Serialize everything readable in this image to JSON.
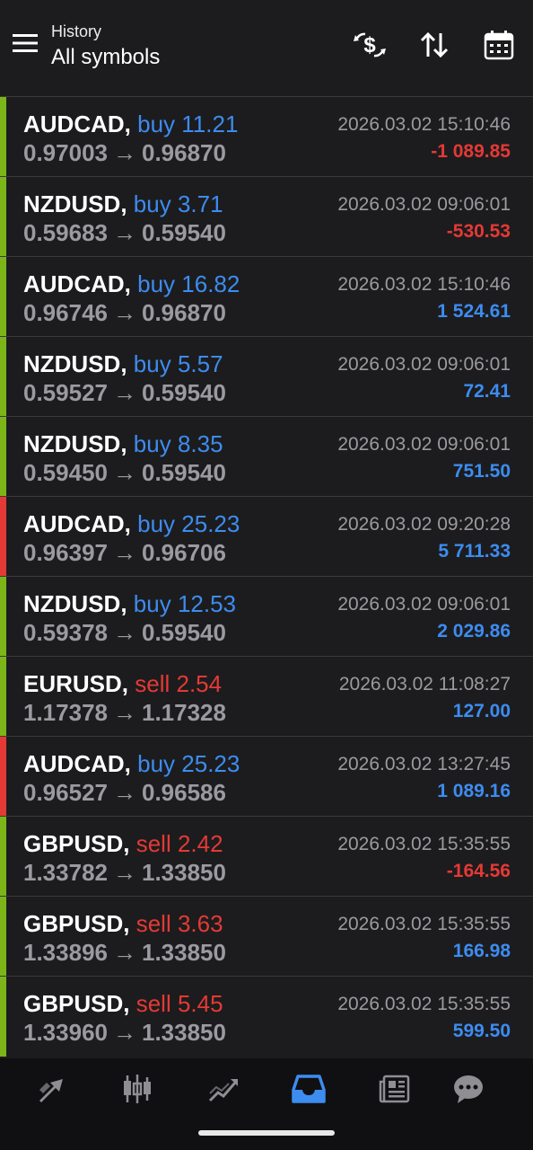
{
  "header": {
    "subtitle": "History",
    "title": "All symbols",
    "icons": [
      "menu-icon",
      "dollar-exchange-icon",
      "sort-icon",
      "calendar-icon"
    ]
  },
  "colors": {
    "background": "#1c1c1e",
    "buy": "#3d8cf0",
    "sell": "#e53935",
    "positive": "#3d8cf0",
    "negative": "#e53935",
    "bar_green": "#7cb518",
    "bar_red": "#e53935",
    "active_nav": "#3d8cf0"
  },
  "deals": [
    {
      "symbol": "AUDCAD,",
      "side": "buy",
      "volume": "buy 11.21",
      "open_price": "0.97003",
      "close_price": "0.96870",
      "time": "2026.03.02 15:10:46",
      "profit": "-1 089.85",
      "profit_sign": "neg",
      "bar": "green"
    },
    {
      "symbol": "NZDUSD,",
      "side": "buy",
      "volume": "buy 3.71",
      "open_price": "0.59683",
      "close_price": "0.59540",
      "time": "2026.03.02 09:06:01",
      "profit": "-530.53",
      "profit_sign": "neg",
      "bar": "green"
    },
    {
      "symbol": "AUDCAD,",
      "side": "buy",
      "volume": "buy 16.82",
      "open_price": "0.96746",
      "close_price": "0.96870",
      "time": "2026.03.02 15:10:46",
      "profit": "1 524.61",
      "profit_sign": "pos",
      "bar": "green"
    },
    {
      "symbol": "NZDUSD,",
      "side": "buy",
      "volume": "buy 5.57",
      "open_price": "0.59527",
      "close_price": "0.59540",
      "time": "2026.03.02 09:06:01",
      "profit": "72.41",
      "profit_sign": "pos",
      "bar": "green"
    },
    {
      "symbol": "NZDUSD,",
      "side": "buy",
      "volume": "buy 8.35",
      "open_price": "0.59450",
      "close_price": "0.59540",
      "time": "2026.03.02 09:06:01",
      "profit": "751.50",
      "profit_sign": "pos",
      "bar": "green"
    },
    {
      "symbol": "AUDCAD,",
      "side": "buy",
      "volume": "buy 25.23",
      "open_price": "0.96397",
      "close_price": "0.96706",
      "time": "2026.03.02 09:20:28",
      "profit": "5 711.33",
      "profit_sign": "pos",
      "bar": "red"
    },
    {
      "symbol": "NZDUSD,",
      "side": "buy",
      "volume": "buy 12.53",
      "open_price": "0.59378",
      "close_price": "0.59540",
      "time": "2026.03.02 09:06:01",
      "profit": "2 029.86",
      "profit_sign": "pos",
      "bar": "green"
    },
    {
      "symbol": "EURUSD,",
      "side": "sell",
      "volume": "sell 2.54",
      "open_price": "1.17378",
      "close_price": "1.17328",
      "time": "2026.03.02 11:08:27",
      "profit": "127.00",
      "profit_sign": "pos",
      "bar": "green"
    },
    {
      "symbol": "AUDCAD,",
      "side": "buy",
      "volume": "buy 25.23",
      "open_price": "0.96527",
      "close_price": "0.96586",
      "time": "2026.03.02 13:27:45",
      "profit": "1 089.16",
      "profit_sign": "pos",
      "bar": "red"
    },
    {
      "symbol": "GBPUSD,",
      "side": "sell",
      "volume": "sell 2.42",
      "open_price": "1.33782",
      "close_price": "1.33850",
      "time": "2026.03.02 15:35:55",
      "profit": "-164.56",
      "profit_sign": "neg",
      "bar": "green"
    },
    {
      "symbol": "GBPUSD,",
      "side": "sell",
      "volume": "sell 3.63",
      "open_price": "1.33896",
      "close_price": "1.33850",
      "time": "2026.03.02 15:35:55",
      "profit": "166.98",
      "profit_sign": "pos",
      "bar": "green"
    },
    {
      "symbol": "GBPUSD,",
      "side": "sell",
      "volume": "sell 5.45",
      "open_price": "1.33960",
      "close_price": "1.33850",
      "time": "2026.03.02 15:35:55",
      "profit": "599.50",
      "profit_sign": "pos",
      "bar": "green"
    }
  ],
  "arrow": "→",
  "bottom_nav": {
    "items": [
      {
        "name": "quotes-icon",
        "active": false
      },
      {
        "name": "chart-candles-icon",
        "active": false
      },
      {
        "name": "trade-icon",
        "active": false
      },
      {
        "name": "history-inbox-icon",
        "active": true
      },
      {
        "name": "news-icon",
        "active": false
      },
      {
        "name": "chat-icon",
        "active": false
      }
    ]
  }
}
